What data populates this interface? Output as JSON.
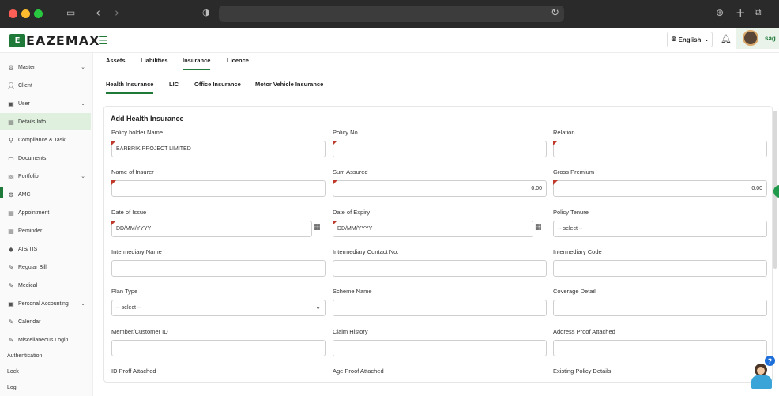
{
  "app": {
    "logo_mark": "E",
    "logo_text": "EAZEMAX"
  },
  "header": {
    "language": "English",
    "username": "sag"
  },
  "sidebar": {
    "items": [
      {
        "label": "Master",
        "icon": "person-gear-icon",
        "chevron": true
      },
      {
        "label": "Client",
        "icon": "person-icon",
        "chevron": false
      },
      {
        "label": "User",
        "icon": "briefcase-icon",
        "chevron": true
      },
      {
        "label": "Details Info",
        "icon": "document-icon",
        "chevron": false,
        "active": true
      },
      {
        "label": "Compliance & Task",
        "icon": "tasks-icon",
        "chevron": false
      },
      {
        "label": "Documents",
        "icon": "folder-icon",
        "chevron": false
      },
      {
        "label": "Portfolio",
        "icon": "portfolio-icon",
        "chevron": true
      },
      {
        "label": "AMC",
        "icon": "gear-icon",
        "chevron": false
      },
      {
        "label": "Appointment",
        "icon": "calendar-doc-icon",
        "chevron": false
      },
      {
        "label": "Reminder",
        "icon": "reminder-icon",
        "chevron": false
      },
      {
        "label": "AIS/TIS",
        "icon": "tag-icon",
        "chevron": false
      },
      {
        "label": "Regular Bill",
        "icon": "user-edit-icon",
        "chevron": false
      },
      {
        "label": "Medical",
        "icon": "user-edit-icon",
        "chevron": false
      },
      {
        "label": "Personal Accounting",
        "icon": "briefcase-icon",
        "chevron": true
      },
      {
        "label": "Calendar",
        "icon": "user-edit-icon",
        "chevron": false
      },
      {
        "label": "Miscellaneous Login",
        "icon": "user-edit-icon",
        "chevron": false
      },
      {
        "label": "Authentication",
        "icon": "",
        "chevron": false
      },
      {
        "label": "Lock",
        "icon": "",
        "chevron": false
      },
      {
        "label": "Log",
        "icon": "",
        "chevron": false
      }
    ]
  },
  "tabs": [
    {
      "label": "Assets"
    },
    {
      "label": "Liabilities"
    },
    {
      "label": "Insurance",
      "active": true
    },
    {
      "label": "Licence"
    }
  ],
  "subtabs": [
    {
      "label": "Health Insurance",
      "active": true
    },
    {
      "label": "LIC"
    },
    {
      "label": "Office Insurance"
    },
    {
      "label": "Motor Vehicle Insurance"
    }
  ],
  "form": {
    "title": "Add Health Insurance",
    "fields": {
      "policy_holder_name": {
        "label": "Policy holder Name",
        "value": "BARBRIK PROJECT LIMITED"
      },
      "policy_no": {
        "label": "Policy No",
        "value": ""
      },
      "relation": {
        "label": "Relation",
        "value": ""
      },
      "name_of_insurer": {
        "label": "Name of Insurer",
        "value": ""
      },
      "sum_assured": {
        "label": "Sum Assured",
        "value": "0.00"
      },
      "gross_premium": {
        "label": "Gross Premium",
        "value": "0.00"
      },
      "date_of_issue": {
        "label": "Date of Issue",
        "placeholder": "DD/MM/YYYY"
      },
      "date_of_expiry": {
        "label": "Date of Expiry",
        "placeholder": "DD/MM/YYYY"
      },
      "policy_tenure": {
        "label": "Policy Tenure",
        "value": "-- select --"
      },
      "intermediary_name": {
        "label": "Intermediary Name",
        "value": ""
      },
      "intermediary_contact": {
        "label": "Intermediary Contact No.",
        "value": ""
      },
      "intermediary_code": {
        "label": "Intermediary Code",
        "value": ""
      },
      "plan_type": {
        "label": "Plan Type",
        "value": "-- select --"
      },
      "scheme_name": {
        "label": "Scheme Name",
        "value": ""
      },
      "coverage_detail": {
        "label": "Coverage Detail",
        "value": ""
      },
      "member_customer_id": {
        "label": "Member/Customer ID",
        "value": ""
      },
      "claim_history": {
        "label": "Claim History",
        "value": ""
      },
      "address_proof": {
        "label": "Address Proof Attached",
        "value": ""
      },
      "id_proof": {
        "label": "ID Proff Attached"
      },
      "age_proof": {
        "label": "Age Proof Attached"
      },
      "existing_policy": {
        "label": "Existing Policy Details"
      }
    }
  },
  "colors": {
    "accent": "#1f7a3a",
    "required_marker": "#c0392b",
    "active_bg": "#dff0df"
  }
}
